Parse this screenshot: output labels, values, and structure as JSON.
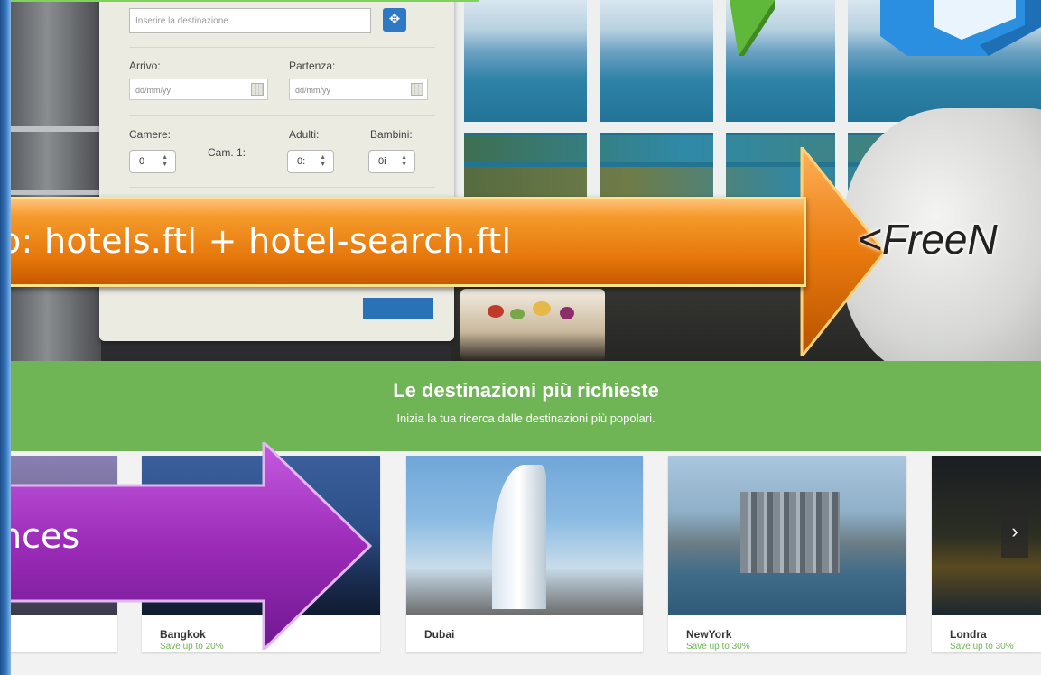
{
  "search_form": {
    "destination_placeholder": "Inserire la destinazione...",
    "locate_icon": "crosshair-icon",
    "arrival_label": "Arrivo:",
    "departure_label": "Partenza:",
    "arrival_placeholder": "dd/mm/yy",
    "departure_placeholder": "dd/mm/yy",
    "rooms_label": "Camere:",
    "room1_label": "Cam. 1:",
    "adults_label": "Adulti:",
    "children_label": "Bambini:",
    "rooms_value": "0",
    "adults_value": "0:",
    "children_value": "0i"
  },
  "overlays": {
    "orange_banner_text": "o: hotels.ftl + hotel-search.ftl",
    "freemarker_text": "<FreeN",
    "purple_callout_text": "nces"
  },
  "destinations": {
    "title": "Le destinazioni più richieste",
    "subtitle": "Inizia la tua ricerca dalle destinazioni più popolari.",
    "cards": [
      {
        "name": "",
        "deal": ""
      },
      {
        "name": "Bangkok",
        "deal": "Save up to 20%"
      },
      {
        "name": "Dubai",
        "deal": ""
      },
      {
        "name": "NewYork",
        "deal": "Save up to 30%"
      },
      {
        "name": "Londra",
        "deal": "Save up to 30%"
      }
    ],
    "next_label": "›"
  },
  "colors": {
    "green": "#6fb555",
    "blue_button": "#2f78c4",
    "orange": "#e5760a",
    "purple": "#9b2bb8"
  }
}
